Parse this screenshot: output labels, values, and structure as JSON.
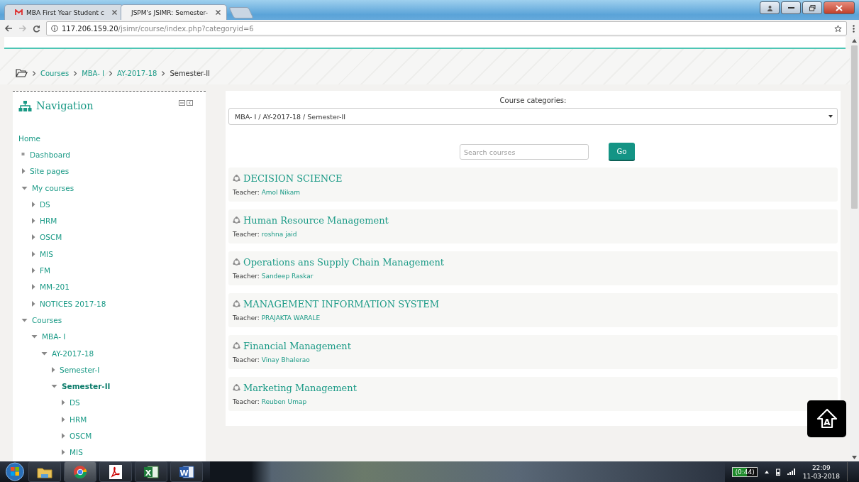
{
  "browser": {
    "tabs": [
      {
        "label": "MBA First Year Student c",
        "selected": false,
        "kind": "mail"
      },
      {
        "label": "JSPM's JSIMR: Semester-",
        "selected": true,
        "kind": "page"
      }
    ],
    "address": {
      "host": "117.206.159.20",
      "path": "/jsimr/course/index.php?categoryid=6"
    }
  },
  "breadcrumb": [
    {
      "label": "Courses",
      "kind": "link"
    },
    {
      "label": "MBA- I",
      "kind": "link"
    },
    {
      "label": "AY-2017-18",
      "kind": "link"
    },
    {
      "label": "Semester-II",
      "kind": "current"
    }
  ],
  "navigation": {
    "title": "Navigation",
    "items": [
      {
        "label": "Home",
        "kind": "plain",
        "selected": false
      },
      {
        "label": "Dashboard",
        "kind": "leaf",
        "selected": false
      },
      {
        "label": "Site pages",
        "kind": "branch",
        "expanded": false,
        "selected": false
      },
      {
        "label": "My courses",
        "kind": "branch",
        "expanded": true,
        "selected": false,
        "children": [
          {
            "label": "DS",
            "kind": "branch",
            "expanded": false,
            "selected": false
          },
          {
            "label": "HRM",
            "kind": "branch",
            "expanded": false,
            "selected": false
          },
          {
            "label": "OSCM",
            "kind": "branch",
            "expanded": false,
            "selected": false
          },
          {
            "label": "MIS",
            "kind": "branch",
            "expanded": false,
            "selected": false
          },
          {
            "label": "FM",
            "kind": "branch",
            "expanded": false,
            "selected": false
          },
          {
            "label": "MM-201",
            "kind": "branch",
            "expanded": false,
            "selected": false
          },
          {
            "label": "NOTICES 2017-18",
            "kind": "branch",
            "expanded": false,
            "selected": false
          }
        ]
      },
      {
        "label": "Courses",
        "kind": "branch",
        "expanded": true,
        "selected": false,
        "children": [
          {
            "label": "MBA- I",
            "kind": "branch",
            "expanded": true,
            "selected": false,
            "children": [
              {
                "label": "AY-2017-18",
                "kind": "branch",
                "expanded": true,
                "selected": false,
                "children": [
                  {
                    "label": "Semester-I",
                    "kind": "branch",
                    "expanded": false,
                    "selected": false
                  },
                  {
                    "label": "Semester-II",
                    "kind": "branch",
                    "expanded": true,
                    "selected": true,
                    "children": [
                      {
                        "label": "DS",
                        "kind": "branch",
                        "expanded": false,
                        "selected": false
                      },
                      {
                        "label": "HRM",
                        "kind": "branch",
                        "expanded": false,
                        "selected": false
                      },
                      {
                        "label": "OSCM",
                        "kind": "branch",
                        "expanded": false,
                        "selected": false
                      },
                      {
                        "label": "MIS",
                        "kind": "branch",
                        "expanded": false,
                        "selected": false
                      }
                    ]
                  }
                ]
              }
            ]
          }
        ]
      }
    ]
  },
  "main": {
    "categories_label": "Course categories:",
    "category_value": "MBA- I / AY-2017-18 / Semester-II",
    "search": {
      "placeholder": "Search courses"
    },
    "go_button": "Go",
    "courses": [
      {
        "title": "DECISION SCIENCE",
        "teacher_label": "Teacher:",
        "teacher": "Amol Nikam"
      },
      {
        "title": "Human Resource Management",
        "teacher_label": "Teacher:",
        "teacher": "roshna jaid"
      },
      {
        "title": "Operations ans Supply Chain Management",
        "teacher_label": "Teacher:",
        "teacher": "Sandeep Raskar"
      },
      {
        "title": "MANAGEMENT INFORMATION SYSTEM",
        "teacher_label": "Teacher:",
        "teacher": "PRAJAKTA WARALE"
      },
      {
        "title": "Financial Management",
        "teacher_label": "Teacher:",
        "teacher": "Vinay Bhalerao"
      },
      {
        "title": "Marketing Management",
        "teacher_label": "Teacher:",
        "teacher": "Reuben Umap"
      }
    ]
  },
  "accessibility_button": {
    "label": "A"
  },
  "taskbar": {
    "apps": [
      {
        "kind": "folder",
        "selected": false
      },
      {
        "kind": "chrome",
        "selected": true
      },
      {
        "kind": "pdf",
        "selected": false
      },
      {
        "kind": "excel",
        "label": "X",
        "selected": false
      },
      {
        "kind": "word",
        "label": "W",
        "selected": false
      }
    ],
    "battery": "(0:44)",
    "time": "22:09",
    "date": "11-03-2018"
  }
}
